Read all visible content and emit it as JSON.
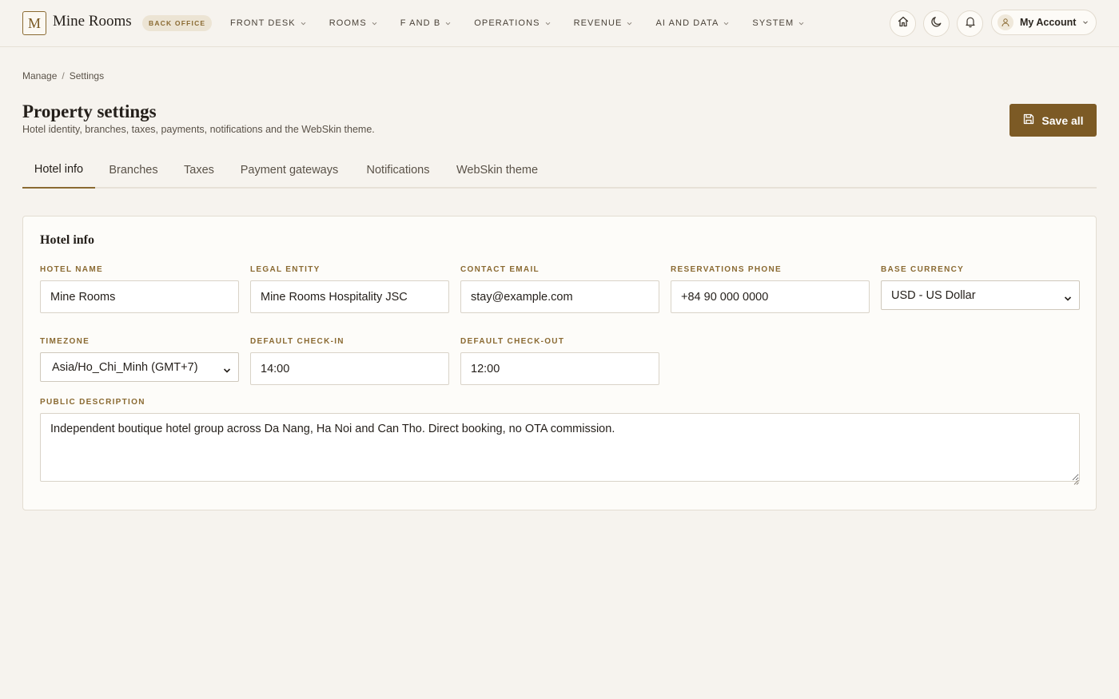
{
  "brand": {
    "logo_letter": "M",
    "name": "Mine Rooms",
    "badge": "BACK OFFICE"
  },
  "nav": [
    {
      "label": "FRONT DESK"
    },
    {
      "label": "ROOMS"
    },
    {
      "label": "F AND B"
    },
    {
      "label": "OPERATIONS"
    },
    {
      "label": "REVENUE"
    },
    {
      "label": "AI AND DATA"
    },
    {
      "label": "SYSTEM"
    }
  ],
  "topbar_icons": [
    "home-icon",
    "moon-icon",
    "bell-icon"
  ],
  "account": {
    "label": "My Account",
    "icon": "user-icon"
  },
  "breadcrumb": {
    "parent": "Manage",
    "separator": "/",
    "current": "Settings"
  },
  "header": {
    "title": "Property settings",
    "subtitle": "Hotel identity, branches, taxes, payments, notifications and the WebSkin theme.",
    "save_label": "Save all",
    "save_icon": "save-icon"
  },
  "tabs": [
    {
      "label": "Hotel info",
      "active": true
    },
    {
      "label": "Branches",
      "active": false
    },
    {
      "label": "Taxes",
      "active": false
    },
    {
      "label": "Payment gateways",
      "active": false
    },
    {
      "label": "Notifications",
      "active": false
    },
    {
      "label": "WebSkin theme",
      "active": false
    }
  ],
  "form": {
    "title": "Hotel info",
    "hotel_name": {
      "label": "HOTEL NAME",
      "value": "Mine Rooms"
    },
    "legal_entity": {
      "label": "LEGAL ENTITY",
      "value": "Mine Rooms Hospitality JSC"
    },
    "contact_email": {
      "label": "CONTACT EMAIL",
      "value": "stay@example.com"
    },
    "reservations_phone": {
      "label": "RESERVATIONS PHONE",
      "value": "+84 90 000 0000"
    },
    "base_currency": {
      "label": "BASE CURRENCY",
      "value": "USD - US Dollar"
    },
    "timezone": {
      "label": "TIMEZONE",
      "value": "Asia/Ho_Chi_Minh (GMT+7)"
    },
    "default_checkin": {
      "label": "DEFAULT CHECK-IN",
      "value": "14:00"
    },
    "default_checkout": {
      "label": "DEFAULT CHECK-OUT",
      "value": "12:00"
    },
    "public_description": {
      "label": "PUBLIC DESCRIPTION",
      "value": "Independent boutique hotel group across Da Nang, Ha Noi and Can Tho. Direct booking, no OTA commission."
    }
  },
  "colors": {
    "accent": "#7c5a25",
    "label": "#8a6a32",
    "background": "#f6f3ee"
  }
}
